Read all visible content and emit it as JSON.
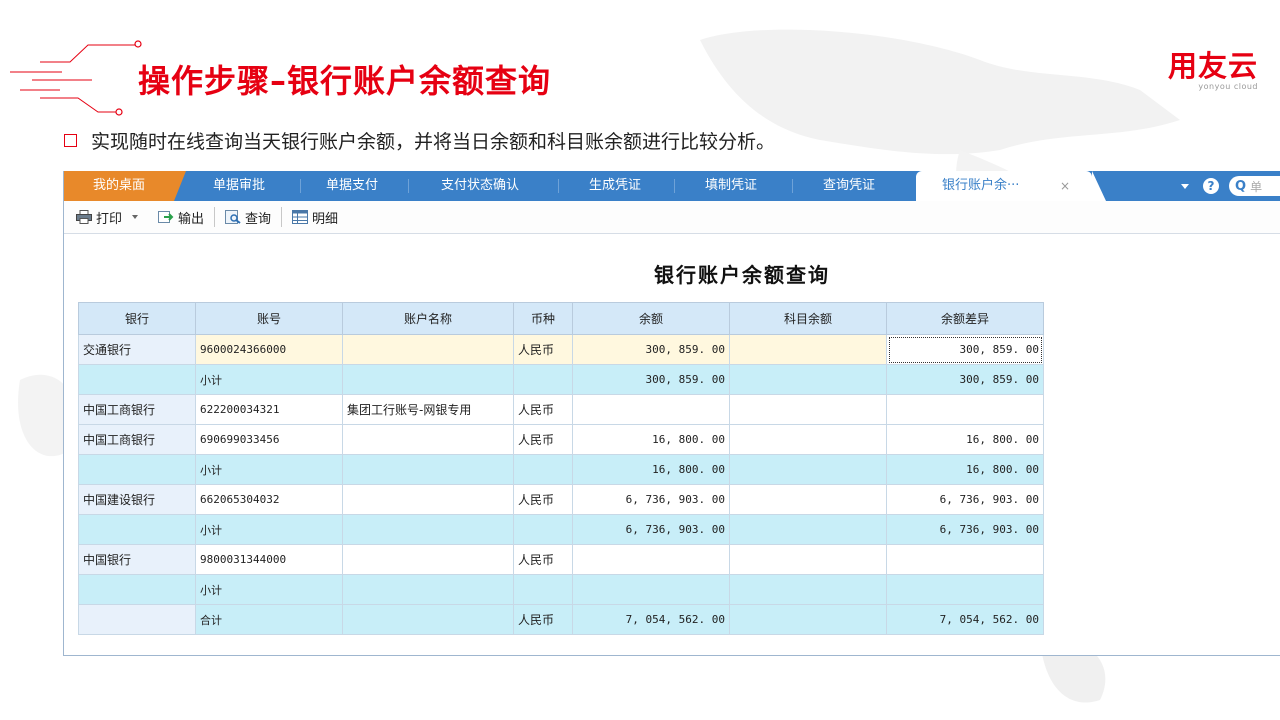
{
  "slide": {
    "title": "操作步骤–银行账户余额查询",
    "bullet": "实现随时在线查询当天银行账户余额，并将当日余额和科目账余额进行比较分析。",
    "logo_text": "用友云",
    "logo_sub": "yonyou cloud",
    "brand_color": "#e60012"
  },
  "tabs": [
    {
      "label": "我的桌面"
    },
    {
      "label": "单据审批"
    },
    {
      "label": "单据支付"
    },
    {
      "label": "支付状态确认"
    },
    {
      "label": "生成凭证"
    },
    {
      "label": "填制凭证"
    },
    {
      "label": "查询凭证"
    },
    {
      "label": "银行账户余···"
    }
  ],
  "tab_close": "×",
  "help_glyph": "?",
  "search": {
    "icon": "Q",
    "placeholder": "单"
  },
  "toolbar": {
    "print": "打印",
    "export": "输出",
    "query": "查询",
    "detail": "明细"
  },
  "report": {
    "title": "银行账户余额查询",
    "columns": [
      "银行",
      "账号",
      "账户名称",
      "币种",
      "余额",
      "科目余额",
      "余额差异"
    ],
    "rows": [
      {
        "kind": "sel",
        "bank": "交通银行",
        "account": "9600024366000",
        "name": "",
        "currency": "人民币",
        "balance": "300, 859. 00",
        "ledger": "",
        "diff": "300, 859. 00"
      },
      {
        "kind": "sub",
        "bank": "",
        "account": "小计",
        "name": "",
        "currency": "",
        "balance": "300, 859. 00",
        "ledger": "",
        "diff": "300, 859. 00"
      },
      {
        "kind": "detail",
        "bank": "中国工商银行",
        "account": "622200034321",
        "name": "集团工行账号-网银专用",
        "currency": "人民币",
        "balance": "",
        "ledger": "",
        "diff": ""
      },
      {
        "kind": "detail",
        "bank": "中国工商银行",
        "account": "690699033456",
        "name": "",
        "currency": "人民币",
        "balance": "16, 800. 00",
        "ledger": "",
        "diff": "16, 800. 00"
      },
      {
        "kind": "sub",
        "bank": "",
        "account": "小计",
        "name": "",
        "currency": "",
        "balance": "16, 800. 00",
        "ledger": "",
        "diff": "16, 800. 00"
      },
      {
        "kind": "detail",
        "bank": "中国建设银行",
        "account": "662065304032",
        "name": "",
        "currency": "人民币",
        "balance": "6, 736, 903. 00",
        "ledger": "",
        "diff": "6, 736, 903. 00"
      },
      {
        "kind": "sub",
        "bank": "",
        "account": "小计",
        "name": "",
        "currency": "",
        "balance": "6, 736, 903. 00",
        "ledger": "",
        "diff": "6, 736, 903. 00"
      },
      {
        "kind": "detail",
        "bank": "中国银行",
        "account": "9800031344000",
        "name": "",
        "currency": "人民币",
        "balance": "",
        "ledger": "",
        "diff": ""
      },
      {
        "kind": "sub",
        "bank": "",
        "account": "小计",
        "name": "",
        "currency": "",
        "balance": "",
        "ledger": "",
        "diff": ""
      },
      {
        "kind": "total",
        "bank": "",
        "account": "合计",
        "name": "",
        "currency": "人民币",
        "balance": "7, 054, 562. 00",
        "ledger": "",
        "diff": "7, 054, 562. 00"
      }
    ]
  },
  "colors": {
    "tab_bar": "#3a80c8",
    "home_tab": "#e8892a",
    "header_cell": "#d4e8f8",
    "subtotal_row": "#c8eef8",
    "selected_row": "#fff8df"
  }
}
